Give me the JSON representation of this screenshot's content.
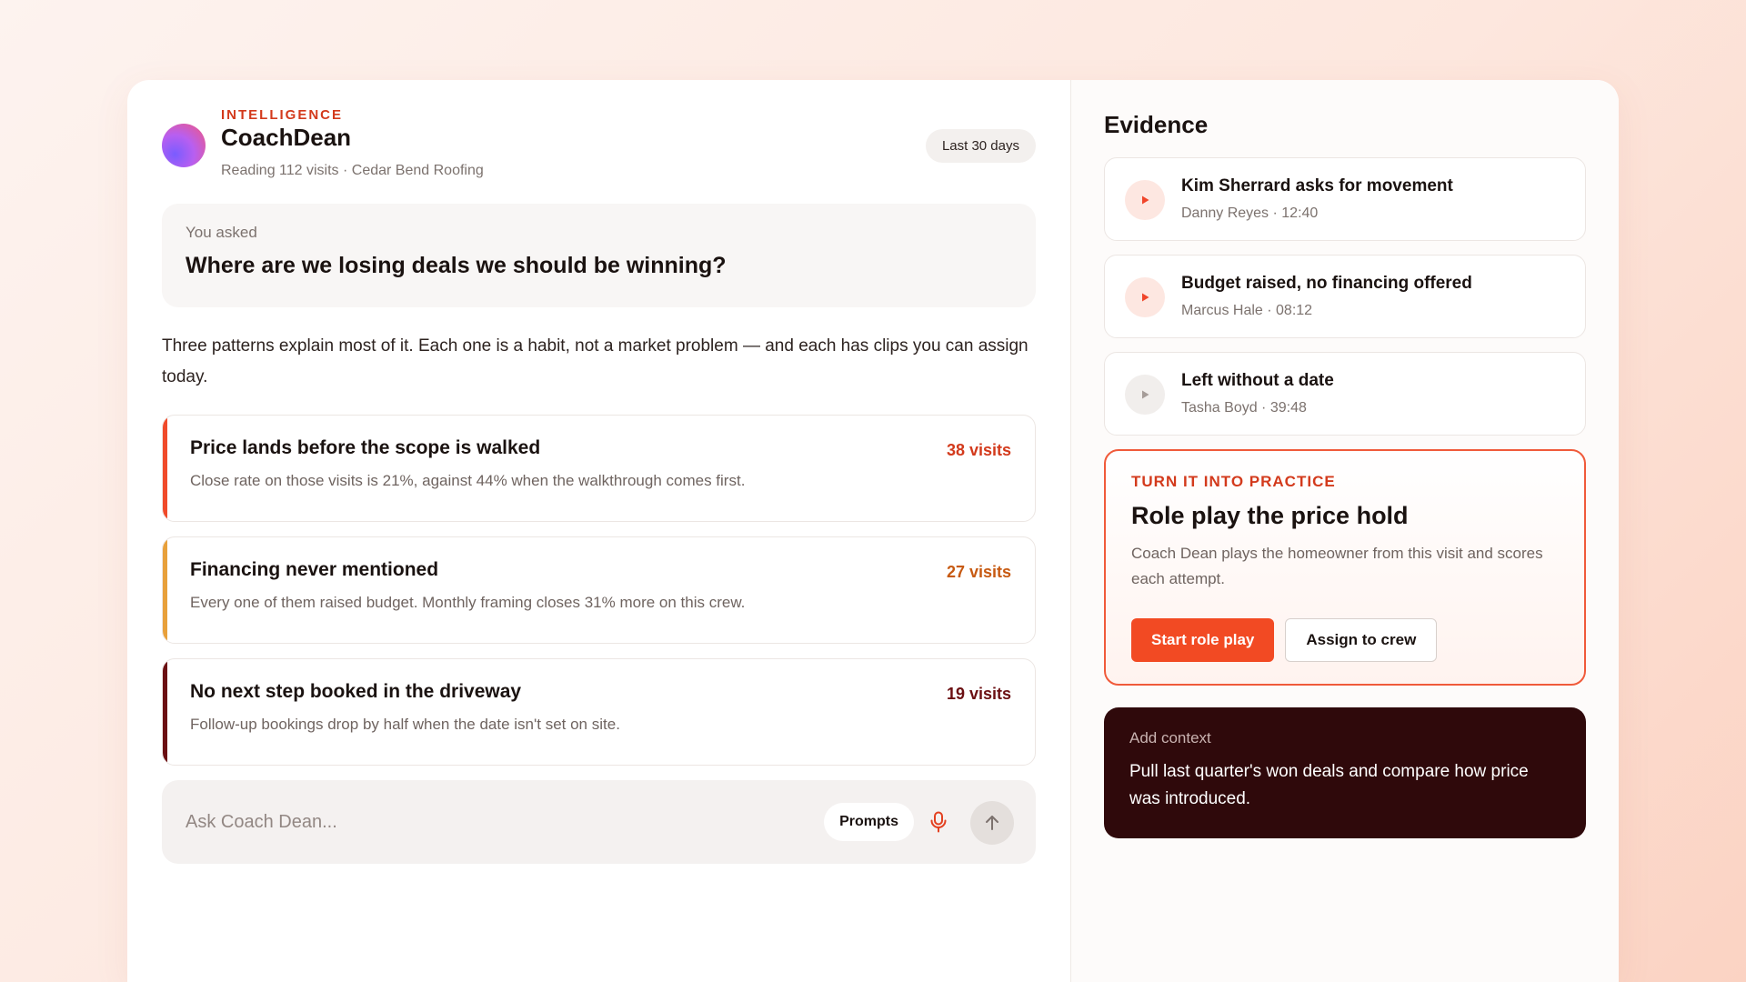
{
  "header": {
    "eyebrow": "INTELLIGENCE",
    "title": "CoachDean",
    "subtitle": "Reading 112 visits · Cedar Bend Roofing",
    "range_label": "Last 30 days"
  },
  "question": {
    "label": "You asked",
    "text": "Where are we losing deals we should be winning?"
  },
  "answer": "Three patterns explain most of it. Each one is a habit, not a market problem — and each has clips you can assign today.",
  "patterns": [
    {
      "title": "Price lands before the scope is walked",
      "description": "Close rate on those visits is 21%, against 44% when the walkthrough comes first.",
      "count": "38 visits",
      "color": "#f04a2a"
    },
    {
      "title": "Financing never mentioned",
      "description": "Every one of them raised budget. Monthly framing closes 31% more on this crew.",
      "count": "27 visits",
      "color": "#e8a03a"
    },
    {
      "title": "No next step booked in the driveway",
      "description": "Follow-up bookings drop by half when the date isn't set on site.",
      "count": "19 visits",
      "color": "#6b0f12"
    }
  ],
  "ask": {
    "placeholder": "Ask Coach Dean...",
    "prompts_label": "Prompts",
    "mic_icon": "microphone-icon",
    "send_icon": "arrow-up-icon"
  },
  "evidence": {
    "title": "Evidence",
    "clips": [
      {
        "title": "Kim Sherrard asks for movement",
        "meta": "Danny Reyes · 12:40",
        "active": true
      },
      {
        "title": "Budget raised, no financing offered",
        "meta": "Marcus Hale · 08:12",
        "active": true
      },
      {
        "title": "Left without a date",
        "meta": "Tasha Boyd · 39:48",
        "active": false
      }
    ]
  },
  "practice": {
    "eyebrow": "TURN IT INTO PRACTICE",
    "title": "Role play the price hold",
    "description": "Coach Dean plays the homeowner from this visit and scores each attempt.",
    "primary_label": "Start role play",
    "secondary_label": "Assign to crew"
  },
  "context": {
    "label": "Add context",
    "text": "Pull last quarter's won deals and compare how price was introduced."
  },
  "colors": {
    "accent": "#f24a23",
    "brand_red": "#d33a1c",
    "dark_panel": "#2f090b"
  }
}
